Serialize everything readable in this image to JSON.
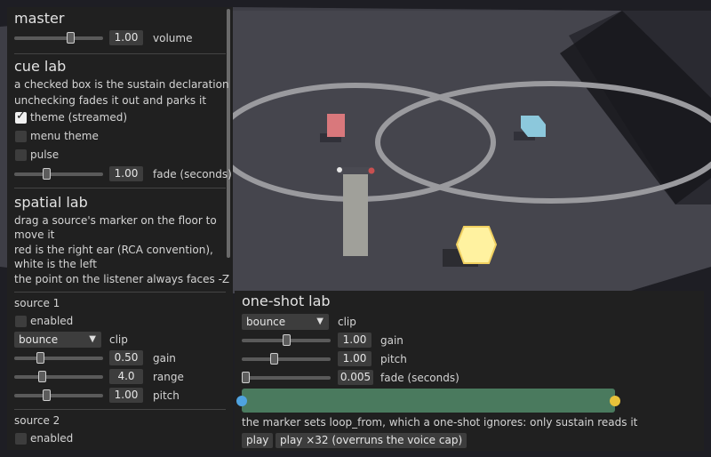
{
  "master": {
    "title": "master",
    "volume": {
      "value": "1.00",
      "label": "volume",
      "level": 0.65
    }
  },
  "cue_lab": {
    "title": "cue lab",
    "desc1": "a checked box is the sustain declaration",
    "desc2": "unchecking fades it out and parks it",
    "items": [
      {
        "label": "theme (streamed)",
        "checked": true
      },
      {
        "label": "menu theme",
        "checked": false
      },
      {
        "label": "pulse",
        "checked": false
      }
    ],
    "fade": {
      "value": "1.00",
      "label": "fade (seconds)",
      "level": 0.35
    }
  },
  "spatial_lab": {
    "title": "spatial lab",
    "desc1a": "drag a source's marker on the floor to",
    "desc1b": "move it",
    "desc2a": "red is the right ear (RCA convention),",
    "desc2b": "white is the left",
    "desc3": "the point on the listener always faces -Z"
  },
  "source1": {
    "title": "source 1",
    "enabled_label": "enabled",
    "clip": "bounce",
    "clip_label": "clip",
    "gain": {
      "value": "0.50",
      "label": "gain",
      "level": 0.28
    },
    "range": {
      "value": "4.0",
      "label": "range",
      "level": 0.3
    },
    "pitch": {
      "value": "1.00",
      "label": "pitch",
      "level": 0.35
    }
  },
  "source2": {
    "title": "source 2",
    "enabled_label": "enabled"
  },
  "oneshot": {
    "title": "one-shot lab",
    "clip": "bounce",
    "clip_label": "clip",
    "gain": {
      "value": "1.00",
      "label": "gain",
      "level": 0.5
    },
    "pitch": {
      "value": "1.00",
      "label": "pitch",
      "level": 0.35
    },
    "fade": {
      "value": "0.005",
      "label": "fade (seconds)",
      "level": 0.0
    },
    "note": "the marker sets loop_from, which a one-shot ignores: only sustain reads it",
    "play_label": "play",
    "play32_label": "play ×32 (overruns the voice cap)"
  },
  "colors": {
    "panel": "#202020",
    "waveform": "#4a7a5e",
    "loop_start": "#4fa3e0",
    "loop_end": "#e8c23a"
  }
}
